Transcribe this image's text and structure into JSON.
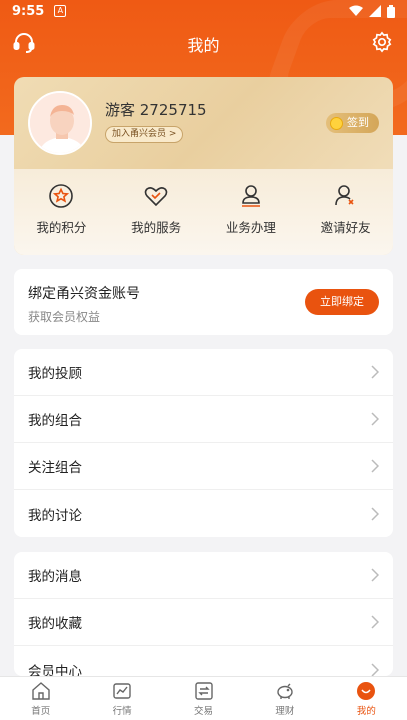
{
  "status_bar": {
    "time": "9:55",
    "notif": "A"
  },
  "header": {
    "title": "我的"
  },
  "profile": {
    "username": "游客 2725715",
    "join_member": "加入甬兴会员 >",
    "signin": "签到"
  },
  "quick_actions": [
    {
      "label": "我的积分",
      "icon": "star-badge-icon"
    },
    {
      "label": "我的服务",
      "icon": "heart-icon"
    },
    {
      "label": "业务办理",
      "icon": "person-icon"
    },
    {
      "label": "邀请好友",
      "icon": "invite-friend-icon"
    }
  ],
  "bind_card": {
    "title": "绑定甬兴资金账号",
    "subtitle": "获取会员权益",
    "button": "立即绑定"
  },
  "list_group_1": [
    {
      "label": "我的投顾"
    },
    {
      "label": "我的组合"
    },
    {
      "label": "关注组合"
    },
    {
      "label": "我的讨论"
    }
  ],
  "list_group_2": [
    {
      "label": "我的消息"
    },
    {
      "label": "我的收藏"
    },
    {
      "label": "会员中心"
    }
  ],
  "tabbar": [
    {
      "label": "首页",
      "icon": "home-icon"
    },
    {
      "label": "行情",
      "icon": "market-chart-icon"
    },
    {
      "label": "交易",
      "icon": "trade-exchange-icon"
    },
    {
      "label": "理财",
      "icon": "piggy-bank-icon"
    },
    {
      "label": "我的",
      "icon": "profile-icon",
      "active": true
    }
  ],
  "colors": {
    "brand": "#e9530f",
    "header": "#f26a1e",
    "gold": "#e9cf9f"
  }
}
